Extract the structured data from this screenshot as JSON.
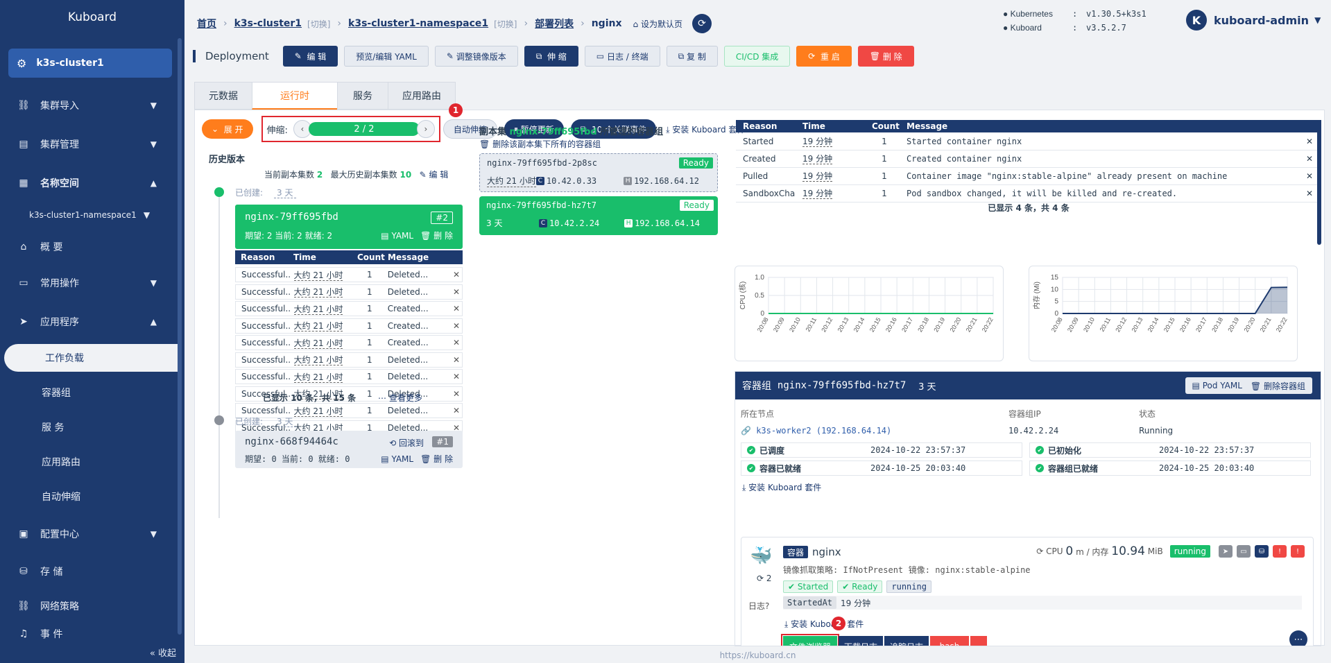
{
  "sidebar": {
    "brand": "Kuboard",
    "cluster": "k3s-cluster1",
    "items": [
      {
        "label": "集群导入",
        "icon": "link-icon"
      },
      {
        "label": "集群管理",
        "icon": "server-icon"
      },
      {
        "label": "名称空间",
        "icon": "grid-icon"
      }
    ],
    "namespace": "k3s-cluster1-namespace1",
    "ns_items": [
      {
        "label": "概 要",
        "icon": "home-icon"
      },
      {
        "label": "常用操作",
        "icon": "folder-icon"
      },
      {
        "label": "应用程序",
        "icon": "send-icon"
      }
    ],
    "app_subs": [
      "工作负载",
      "容器组",
      "服 务",
      "应用路由",
      "自动伸缩"
    ],
    "bottom_items": [
      {
        "label": "配置中心",
        "icon": "briefcase-icon"
      },
      {
        "label": "存 储",
        "icon": "database-icon"
      },
      {
        "label": "网络策略",
        "icon": "link-icon"
      },
      {
        "label": "事 件",
        "icon": "bell-icon"
      }
    ],
    "collapse": "收起"
  },
  "header": {
    "crumbs": [
      {
        "label": "首页"
      },
      {
        "label": "k3s-cluster1",
        "switch": "[切换]"
      },
      {
        "label": "k3s-cluster1-namespace1",
        "switch": "[切换]"
      },
      {
        "label": "部署列表"
      }
    ],
    "current": "nginx",
    "set_default": "设为默认页",
    "versions": [
      {
        "k": "Kubernetes",
        "v": "v1.30.5+k3s1"
      },
      {
        "k": "Kuboard",
        "v": "v3.5.2.7"
      }
    ],
    "user_initial": "K",
    "user": "kuboard-admin"
  },
  "toolbar": {
    "title": "Deployment",
    "edit": "编 辑",
    "yaml": "预览/编辑 YAML",
    "image": "调整镜像版本",
    "scale": "伸 缩",
    "logs": "日志 / 终端",
    "copy": "复 制",
    "cicd": "CI/CD 集成",
    "restart": "重 启",
    "delete": "删 除"
  },
  "tabs": [
    "元数据",
    "运行时",
    "服务",
    "应用路由"
  ],
  "controls": {
    "expand": "展 开",
    "scale_label": "伸缩:",
    "scale_value": "2 / 2",
    "marker1": "1",
    "autoscale": "自动伸缩",
    "pause": "暂停更新",
    "events": "10 个关联事件",
    "install": "安装 Kuboard 套件"
  },
  "history": {
    "title": "历史版本",
    "current_label": "当前副本集数",
    "current_count": "2",
    "max_label": "最大历史副本集数",
    "max_count": "10",
    "edit": "编 辑",
    "created_label": "已创建:",
    "rs1": {
      "created": "3 天",
      "name": "nginx-79ff695fbd",
      "rev": "#2",
      "meta": "期望: 2 当前: 2 就绪: 2",
      "yaml": "YAML",
      "del": "删 除"
    },
    "ev_cols": [
      "Reason",
      "Time",
      "Count",
      "Message"
    ],
    "events": [
      {
        "reason": "Successful...",
        "time": "大约 21 小时",
        "count": "1",
        "msg": "Deleted..."
      },
      {
        "reason": "Successful...",
        "time": "大约 21 小时",
        "count": "1",
        "msg": "Deleted..."
      },
      {
        "reason": "Successful...",
        "time": "大约 21 小时",
        "count": "1",
        "msg": "Created..."
      },
      {
        "reason": "Successful...",
        "time": "大约 21 小时",
        "count": "1",
        "msg": "Created..."
      },
      {
        "reason": "Successful...",
        "time": "大约 21 小时",
        "count": "1",
        "msg": "Created..."
      },
      {
        "reason": "Successful...",
        "time": "大约 21 小时",
        "count": "1",
        "msg": "Deleted..."
      },
      {
        "reason": "Successful...",
        "time": "大约 21 小时",
        "count": "1",
        "msg": "Deleted..."
      },
      {
        "reason": "Successful...",
        "time": "大约 21 小时",
        "count": "1",
        "msg": "Deleted..."
      },
      {
        "reason": "Successful...",
        "time": "大约 21 小时",
        "count": "1",
        "msg": "Deleted..."
      },
      {
        "reason": "Successful...",
        "time": "大约 21 小时",
        "count": "1",
        "msg": "Deleted..."
      }
    ],
    "shown": "已显示 10 条，共 15 条",
    "more": "查看更多",
    "rs2": {
      "created": "3 天",
      "name": "nginx-668f94464c",
      "rollback": "回滚到",
      "rev": "#1",
      "meta": "期望: 0 当前: 0 就绪: 0",
      "yaml": "YAML",
      "del": "删 除"
    }
  },
  "pods": {
    "title_prefix": "副本集",
    "rs_name": "nginx-79ff695fbd",
    "title_suffix": "所管理的容器组",
    "delete_all": "删除该副本集下所有的容器组",
    "list": [
      {
        "name": "nginx-79ff695fbd-2p8sc",
        "status": "Ready",
        "age": "大约 21 小时",
        "cip": "10.42.0.33",
        "hip": "192.168.64.12"
      },
      {
        "name": "nginx-79ff695fbd-hz7t7",
        "status": "Ready",
        "age": "3 天",
        "cip": "10.42.2.24",
        "hip": "192.168.64.14"
      }
    ]
  },
  "events": {
    "cols": [
      "Reason",
      "Time",
      "Count",
      "Message"
    ],
    "rows": [
      {
        "reason": "Started",
        "time": "19 分钟",
        "count": "1",
        "msg": "Started container nginx"
      },
      {
        "reason": "Created",
        "time": "19 分钟",
        "count": "1",
        "msg": "Created container nginx"
      },
      {
        "reason": "Pulled",
        "time": "19 分钟",
        "count": "1",
        "msg": "Container image \"nginx:stable-alpine\" already present on machine"
      },
      {
        "reason": "SandboxCha...",
        "time": "19 分钟",
        "count": "1",
        "msg": "Pod sandbox changed, it will be killed and re-created."
      }
    ],
    "shown": "已显示 4 条，共 4 条"
  },
  "chart_data": [
    {
      "type": "line",
      "ylabel": "CPU (核)",
      "ylim": [
        0,
        1.0
      ],
      "yticks": [
        "0",
        "0.5",
        "1.0"
      ],
      "x": [
        "20:08",
        "20:09",
        "20:10",
        "20:11",
        "20:12",
        "20:13",
        "20:14",
        "20:15",
        "20:16",
        "20:17",
        "20:18",
        "20:19",
        "20:20",
        "20:21",
        "20:22"
      ],
      "series": [
        {
          "values": [
            0,
            0,
            0,
            0,
            0,
            0,
            0,
            0,
            0,
            0,
            0,
            0,
            0,
            0,
            0
          ],
          "color": "#19be6b"
        }
      ],
      "grid": true
    },
    {
      "type": "area",
      "ylabel": "内存 (Mi)",
      "ylim": [
        0,
        15
      ],
      "yticks": [
        "0",
        "5",
        "10",
        "15"
      ],
      "x": [
        "20:08",
        "20:09",
        "20:10",
        "20:11",
        "20:12",
        "20:13",
        "20:14",
        "20:15",
        "20:16",
        "20:17",
        "20:18",
        "20:19",
        "20:20",
        "20:21",
        "20:22"
      ],
      "series": [
        {
          "values": [
            0,
            0,
            0,
            0,
            0,
            0,
            0,
            0,
            0,
            0,
            0,
            0,
            0,
            10.8,
            10.9
          ],
          "color": "#1d3a6e"
        }
      ],
      "grid": true
    }
  ],
  "pod_detail": {
    "title": "容器组",
    "name": "nginx-79ff695fbd-hz7t7",
    "age": "3 天",
    "yaml_btn": "Pod YAML",
    "delete_btn": "删除容器组",
    "node_label": "所在节点",
    "node": "k3s-worker2 (192.168.64.14)",
    "ip_label": "容器组IP",
    "ip": "10.42.2.24",
    "state_label": "状态",
    "state": "Running",
    "conditions": [
      {
        "label": "已调度",
        "time": "2024-10-22 23:57:37"
      },
      {
        "label": "已初始化",
        "time": "2024-10-22 23:57:37"
      },
      {
        "label": "容器已就绪",
        "time": "2024-10-25 20:03:40"
      },
      {
        "label": "容器组已就绪",
        "time": "2024-10-25 20:03:40"
      }
    ],
    "install": "安装 Kuboard 套件",
    "container": {
      "tag": "容器",
      "name": "nginx",
      "restarts": "2",
      "cpu_label": "CPU",
      "cpu": "0",
      "cpu_unit": "m / 内存",
      "mem": "10.94",
      "mem_unit": "MiB",
      "status": "running",
      "pull_policy": "镜像抓取策略: IfNotPresent",
      "image": "镜像: nginx:stable-alpine",
      "started": "Started",
      "ready": "Ready",
      "running": "running",
      "started_at_label": "StartedAt",
      "started_at": "19 分钟",
      "log_label": "日志",
      "install": "安装 Kuboard 套件",
      "btn_files": "文件浏览器",
      "btn_download": "下载日志",
      "btn_follow": "追踪日志",
      "btn_bash": "bash",
      "marker2": "2"
    }
  },
  "footer": "https://kuboard.cn"
}
